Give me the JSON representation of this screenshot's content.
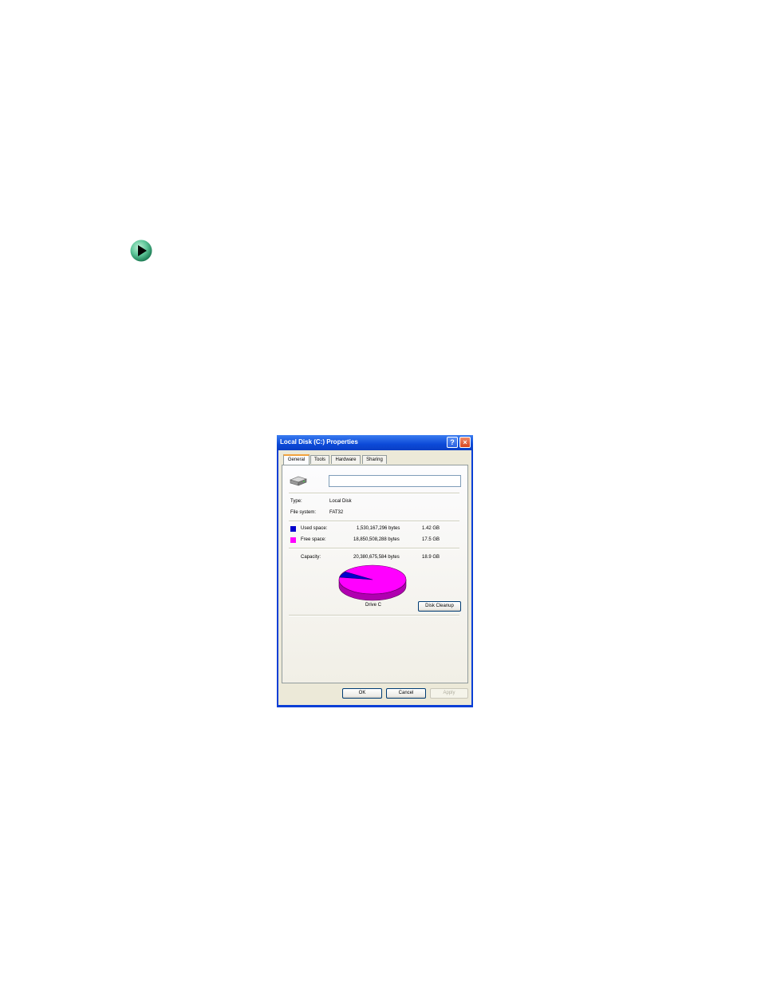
{
  "window": {
    "title": "Local Disk (C:) Properties",
    "help_glyph": "?",
    "close_glyph": "×"
  },
  "tabs": [
    {
      "label": "General",
      "active": true
    },
    {
      "label": "Tools",
      "active": false
    },
    {
      "label": "Hardware",
      "active": false
    },
    {
      "label": "Sharing",
      "active": false
    }
  ],
  "general": {
    "volume_label_value": "",
    "type_label": "Type:",
    "type_value": "Local Disk",
    "fs_label": "File system:",
    "fs_value": "FAT32",
    "used": {
      "label": "Used space:",
      "bytes": "1,530,167,296 bytes",
      "size": "1.42 GB",
      "color": "#0000cc"
    },
    "free": {
      "label": "Free space:",
      "bytes": "18,850,508,288 bytes",
      "size": "17.5 GB",
      "color": "#ff00ff"
    },
    "capacity": {
      "label": "Capacity:",
      "bytes": "20,380,675,584 bytes",
      "size": "18.9 GB"
    },
    "drive_caption": "Drive C",
    "cleanup_label": "Disk Cleanup"
  },
  "buttons": {
    "ok": "OK",
    "cancel": "Cancel",
    "apply": "Apply"
  },
  "icons": {
    "bullet": "green-play-arrow-icon",
    "drive": "hard-drive-icon"
  }
}
